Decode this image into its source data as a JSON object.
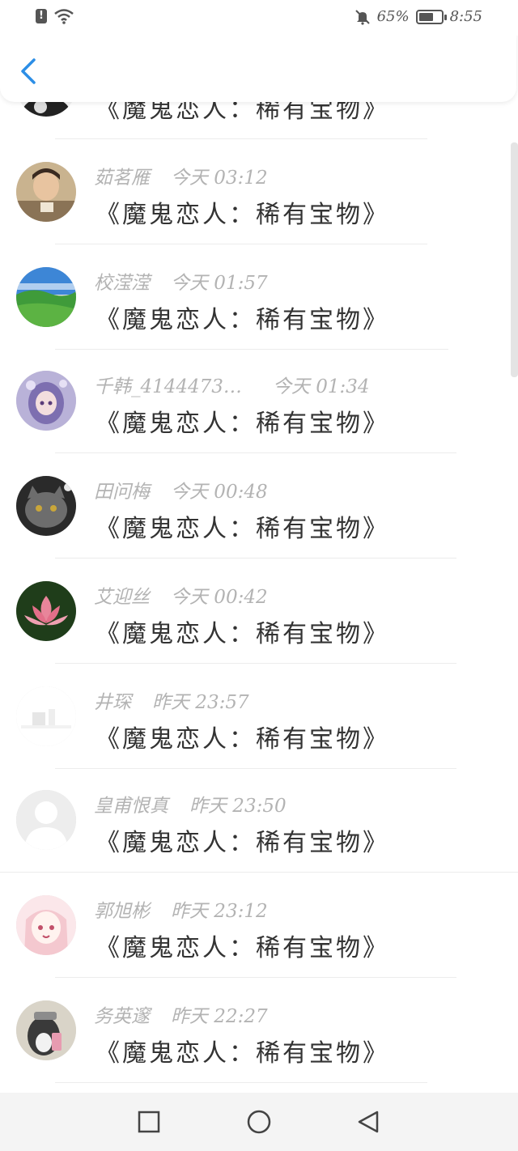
{
  "status_bar": {
    "battery_percent_text": "65%",
    "battery_level": 0.65,
    "time": "8:55"
  },
  "header": {
    "back_icon": "chevron-left-icon",
    "accent_color": "#2c8ee6"
  },
  "rows": [
    {
      "name": "",
      "time": "",
      "message": "《魔鬼恋人：稀有宝物》",
      "avatar": "partial-avatar"
    },
    {
      "name": "茹茗雁",
      "time": "今天 03:12",
      "message": "《魔鬼恋人：稀有宝物》",
      "avatar": "man-photo"
    },
    {
      "name": "校滢滢",
      "time": "今天 01:57",
      "message": "《魔鬼恋人：稀有宝物》",
      "avatar": "landscape-photo"
    },
    {
      "name": "千韩_4144473…",
      "time": "今天 01:34",
      "message": "《魔鬼恋人：稀有宝物》",
      "avatar": "anime-girl-purple"
    },
    {
      "name": "田问梅",
      "time": "今天 00:48",
      "message": "《魔鬼恋人：稀有宝物》",
      "avatar": "grey-cat"
    },
    {
      "name": "艾迎丝",
      "time": "今天 00:42",
      "message": "《魔鬼恋人：稀有宝物》",
      "avatar": "lotus-flower"
    },
    {
      "name": "井琛",
      "time": "昨天 23:57",
      "message": "《魔鬼恋人：稀有宝物》",
      "avatar": "faded-image"
    },
    {
      "name": "皇甫恨真",
      "time": "昨天 23:50",
      "message": "《魔鬼恋人：稀有宝物》",
      "avatar": "default-avatar"
    },
    {
      "name": "郭旭彬",
      "time": "昨天 23:12",
      "message": "《魔鬼恋人：稀有宝物》",
      "avatar": "anime-girl-pink"
    },
    {
      "name": "务英邃",
      "time": "昨天 22:27",
      "message": "《魔鬼恋人：稀有宝物》",
      "avatar": "dog-photo"
    }
  ],
  "nav_bar": {
    "recent_icon": "square-icon",
    "home_icon": "circle-icon",
    "back_icon": "triangle-back-icon"
  }
}
